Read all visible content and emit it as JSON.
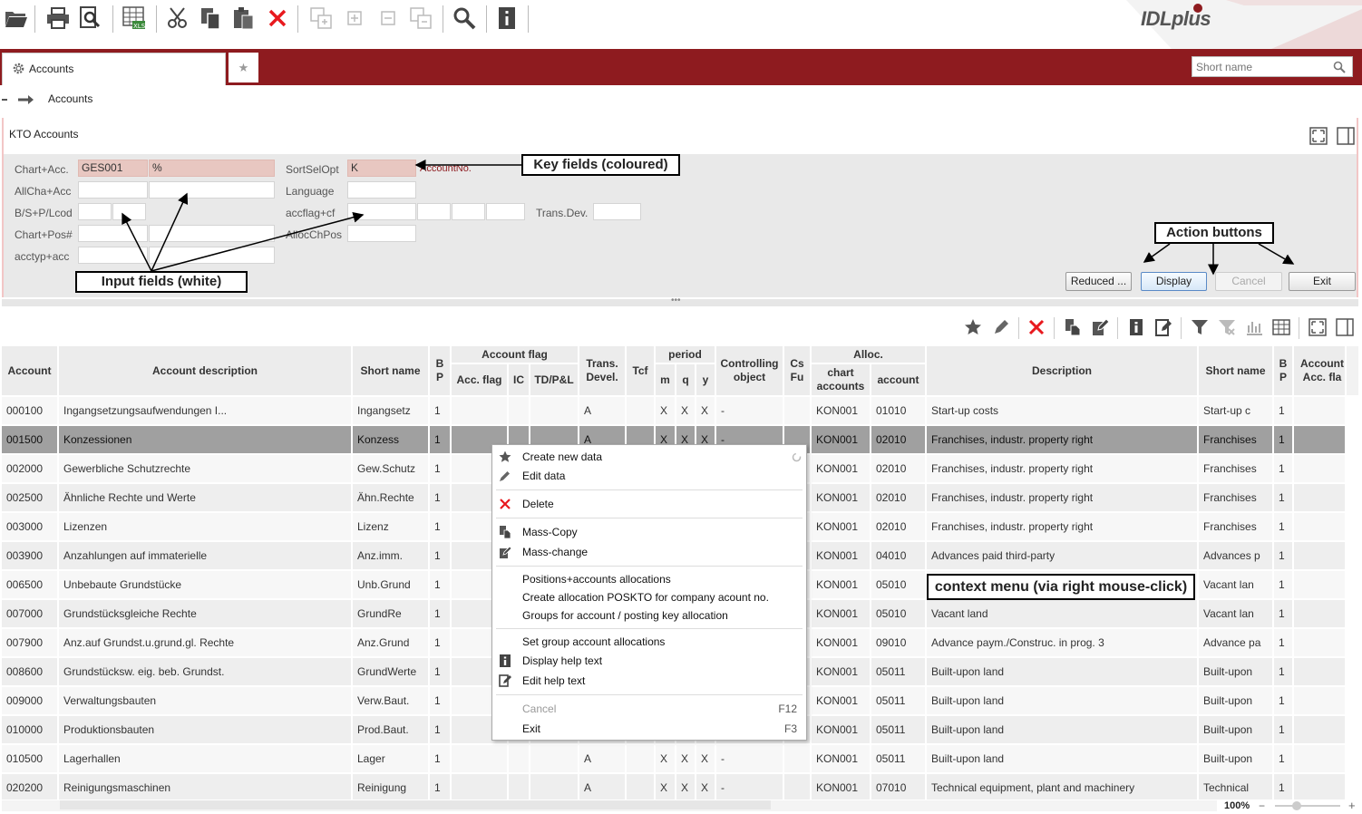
{
  "app": {
    "logo": "IDLplus"
  },
  "tabs": {
    "accounts_label": "Accounts"
  },
  "search": {
    "placeholder": "Short name"
  },
  "breadcrumb": {
    "item": "Accounts"
  },
  "panel": {
    "title": "KTO Accounts"
  },
  "form": {
    "chart_acc_label": "Chart+Acc.",
    "chart_acc_value1": "GES001",
    "chart_acc_value2": "%",
    "sortselopt_label": "SortSelOpt",
    "sortselopt_value": "K",
    "accountno_label": "AccountNo.",
    "allcha_label": "AllCha+Acc",
    "language_label": "Language",
    "bsp_label": "B/S+P/Lcod",
    "accflag_label": "accflag+cf",
    "transdev_label": "Trans.Dev.",
    "chartpos_label": "Chart+Pos#",
    "allocchpos_label": "AllocChPos",
    "acctyp_label": "acctyp+acc"
  },
  "buttons": {
    "reduced": "Reduced ...",
    "display": "Display",
    "cancel": "Cancel",
    "exit": "Exit"
  },
  "callouts": {
    "key_fields": "Key fields (coloured)",
    "input_fields": "Input fields (white)",
    "action_buttons": "Action buttons",
    "context_menu": "context menu (via right mouse-click)"
  },
  "table": {
    "headers": {
      "account": "Account",
      "account_description": "Account description",
      "short_name": "Short name",
      "bp": "B P",
      "account_flag": "Account flag",
      "acc_flag": "Acc. flag",
      "ic": "IC",
      "tdpl": "TD/P&L",
      "trans_devel": "Trans. Devel.",
      "tcf": "Tcf",
      "period": "period",
      "m": "m",
      "q": "q",
      "y": "y",
      "controlling_object": "Controlling object",
      "csfu": "Cs Fu",
      "alloc": "Alloc.",
      "chart_accounts": "chart accounts",
      "alloc_account": "account",
      "description": "Description",
      "short_name2": "Short name",
      "bp2": "B P",
      "account_acc_flag": "Account Acc. fla"
    },
    "rows": [
      {
        "account": "000100",
        "desc": "Ingangsetzungsaufwendungen I...",
        "short": "Ingangsetz",
        "bp": "1",
        "trans": "A",
        "m": "X",
        "q": "X",
        "y": "X",
        "ctrl": "-",
        "chart": "KON001",
        "acct": "01010",
        "description": "Start-up costs",
        "short2": "Start-up c",
        "bp2": "1"
      },
      {
        "account": "001500",
        "desc": "Konzessionen",
        "short": "Konzess",
        "bp": "1",
        "trans": "A",
        "m": "X",
        "q": "X",
        "y": "X",
        "ctrl": "-",
        "chart": "KON001",
        "acct": "02010",
        "description": "Franchises, industr. property right",
        "short2": "Franchises",
        "bp2": "1"
      },
      {
        "account": "002000",
        "desc": "Gewerbliche Schutzrechte",
        "short": "Gew.Schutz",
        "bp": "1",
        "trans": "",
        "m": "",
        "q": "",
        "y": "",
        "ctrl": "",
        "chart": "KON001",
        "acct": "02010",
        "description": "Franchises, industr. property right",
        "short2": "Franchises",
        "bp2": "1"
      },
      {
        "account": "002500",
        "desc": "Ähnliche Rechte und Werte",
        "short": "Ähn.Rechte",
        "bp": "1",
        "trans": "",
        "m": "",
        "q": "",
        "y": "",
        "ctrl": "",
        "chart": "KON001",
        "acct": "02010",
        "description": "Franchises, industr. property right",
        "short2": "Franchises",
        "bp2": "1"
      },
      {
        "account": "003000",
        "desc": "Lizenzen",
        "short": "Lizenz",
        "bp": "1",
        "trans": "",
        "m": "",
        "q": "",
        "y": "",
        "ctrl": "",
        "chart": "KON001",
        "acct": "02010",
        "description": "Franchises, industr. property right",
        "short2": "Franchises",
        "bp2": "1"
      },
      {
        "account": "003900",
        "desc": "Anzahlungen auf immaterielle",
        "short": "Anz.imm.",
        "bp": "1",
        "trans": "",
        "m": "",
        "q": "",
        "y": "",
        "ctrl": "",
        "chart": "KON001",
        "acct": "04010",
        "description": "Advances paid third-party",
        "short2": "Advances p",
        "bp2": "1"
      },
      {
        "account": "006500",
        "desc": "Unbebaute Grundstücke",
        "short": "Unb.Grund",
        "bp": "1",
        "trans": "",
        "m": "",
        "q": "",
        "y": "",
        "ctrl": "",
        "chart": "KON001",
        "acct": "05010",
        "description": "",
        "short2": "Vacant lan",
        "bp2": "1"
      },
      {
        "account": "007000",
        "desc": "Grundstücksgleiche Rechte",
        "short": "GrundRe",
        "bp": "1",
        "trans": "",
        "m": "",
        "q": "",
        "y": "",
        "ctrl": "",
        "chart": "KON001",
        "acct": "05010",
        "description": "Vacant land",
        "short2": "Vacant lan",
        "bp2": "1"
      },
      {
        "account": "007900",
        "desc": "Anz.auf Grundst.u.grund.gl. Rechte",
        "short": "Anz.Grund",
        "bp": "1",
        "trans": "",
        "m": "",
        "q": "",
        "y": "",
        "ctrl": "",
        "chart": "KON001",
        "acct": "09010",
        "description": "Advance paym./Construc. in prog. 3",
        "short2": "Advance pa",
        "bp2": "1"
      },
      {
        "account": "008600",
        "desc": "Grundstücksw. eig. beb. Grundst.",
        "short": "GrundWerte",
        "bp": "1",
        "trans": "",
        "m": "",
        "q": "",
        "y": "",
        "ctrl": "",
        "chart": "KON001",
        "acct": "05011",
        "description": "Built-upon land",
        "short2": "Built-upon",
        "bp2": "1"
      },
      {
        "account": "009000",
        "desc": "Verwaltungsbauten",
        "short": "Verw.Baut.",
        "bp": "1",
        "trans": "",
        "m": "",
        "q": "",
        "y": "",
        "ctrl": "",
        "chart": "KON001",
        "acct": "05011",
        "description": "Built-upon land",
        "short2": "Built-upon",
        "bp2": "1"
      },
      {
        "account": "010000",
        "desc": "Produktionsbauten",
        "short": "Prod.Baut.",
        "bp": "1",
        "trans": "",
        "m": "",
        "q": "",
        "y": "",
        "ctrl": "",
        "chart": "KON001",
        "acct": "05011",
        "description": "Built-upon land",
        "short2": "Built-upon",
        "bp2": "1"
      },
      {
        "account": "010500",
        "desc": "Lagerhallen",
        "short": "Lager",
        "bp": "1",
        "trans": "A",
        "m": "X",
        "q": "X",
        "y": "X",
        "ctrl": "-",
        "chart": "KON001",
        "acct": "05011",
        "description": "Built-upon land",
        "short2": "Built-upon",
        "bp2": "1"
      },
      {
        "account": "020200",
        "desc": "Reinigungsmaschinen",
        "short": "Reinigung",
        "bp": "1",
        "trans": "A",
        "m": "X",
        "q": "X",
        "y": "X",
        "ctrl": "-",
        "chart": "KON001",
        "acct": "07010",
        "description": "Technical equipment, plant and machinery",
        "short2": "Technical",
        "bp2": "1"
      }
    ]
  },
  "context_menu": {
    "create": "Create new data",
    "edit": "Edit data",
    "delete": "Delete",
    "mass_copy": "Mass-Copy",
    "mass_change": "Mass-change",
    "pos_alloc": "Positions+accounts allocations",
    "create_alloc": "Create allocation POSKTO for company acount no.",
    "groups_alloc": "Groups for account / posting key allocation",
    "set_group": "Set group account allocations",
    "display_help": "Display help text",
    "edit_help": "Edit help text",
    "cancel": "Cancel",
    "cancel_key": "F12",
    "exit": "Exit",
    "exit_key": "F3"
  },
  "status": {
    "zoom": "100%"
  },
  "colors": {
    "brand_red": "#8e1b1f",
    "key_field": "#e8c7c1",
    "delete_red": "#e8191e"
  }
}
